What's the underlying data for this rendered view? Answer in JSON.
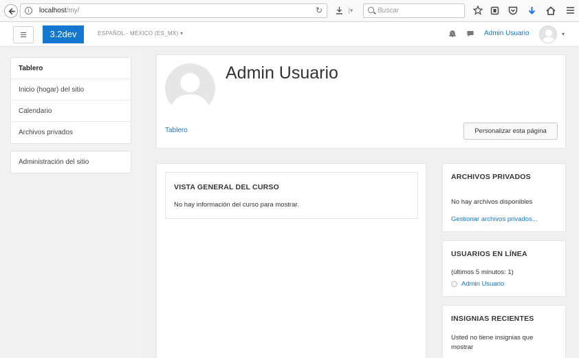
{
  "browser": {
    "url_host": "localhost",
    "url_path": "/my/",
    "search_placeholder": "Buscar"
  },
  "navbar": {
    "brand": "3.2dev",
    "language": "ESPAÑOL - MÉXICO (ES_MX) ▾",
    "user_name": "Admin Usuario",
    "user_caret": "▾"
  },
  "drawer": {
    "primary": [
      {
        "label": "Tablero",
        "active": true
      },
      {
        "label": "Inicio (hogar) del sitio"
      },
      {
        "label": "Calendario"
      },
      {
        "label": "Archivos privados"
      }
    ],
    "secondary": [
      {
        "label": "Administración del sitio"
      }
    ]
  },
  "header": {
    "title": "Admin Usuario",
    "breadcrumb": "Tablero",
    "customize_button": "Personalizar esta página"
  },
  "course_overview": {
    "title": "VISTA GENERAL DEL CURSO",
    "text": "No hay información del curso para mostrar."
  },
  "private_files": {
    "title": "ARCHIVOS PRIVADOS",
    "text": "No hay archivos disponibles",
    "link": "Gestionar archivos privados..."
  },
  "online_users": {
    "title": "USUARIOS EN LÍNEA",
    "text": "(últimos 5 minutos: 1)",
    "user": "Admin Usuario"
  },
  "badges": {
    "title": "INSIGNIAS RECIENTES",
    "text": "Usted no tiene insignias que mostrar"
  },
  "colors": {
    "brand": "#1177d1",
    "link": "#1177d1",
    "page_bg": "#f0f0f0"
  }
}
